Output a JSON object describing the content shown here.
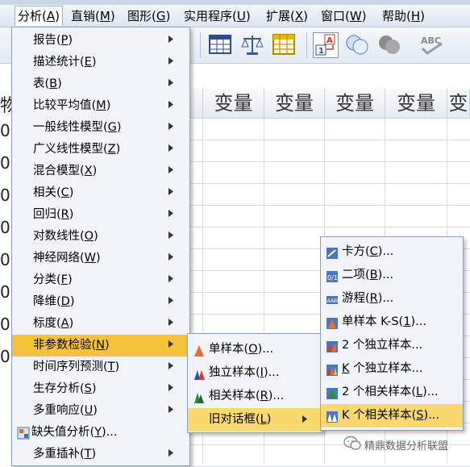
{
  "menubar": {
    "items": [
      {
        "label": "分析",
        "key": "A"
      },
      {
        "label": "直销",
        "key": "M"
      },
      {
        "label": "图形",
        "key": "G"
      },
      {
        "label": "实用程序",
        "key": "U"
      },
      {
        "label": "扩展",
        "key": "X"
      },
      {
        "label": "窗口",
        "key": "W"
      },
      {
        "label": "帮助",
        "key": "H"
      }
    ]
  },
  "toolbar": {
    "icons": [
      "table-icon",
      "scale-icon",
      "grid-icon",
      "value-labels-icon",
      "circles-icon",
      "sets-icon",
      "spell-check-icon"
    ],
    "abc_text": "ABC"
  },
  "grid": {
    "column_header": "变量",
    "left_partial_header": "物",
    "left_partial_cells": [
      "0",
      "0",
      "0",
      "0",
      "0",
      "0",
      "0",
      "0"
    ]
  },
  "analyze_menu": {
    "items": [
      {
        "label": "报告",
        "key": "P",
        "submenu": true
      },
      {
        "label": "描述统计",
        "key": "E",
        "submenu": true
      },
      {
        "label": "表",
        "key": "B",
        "submenu": true
      },
      {
        "label": "比较平均值",
        "key": "M",
        "submenu": true
      },
      {
        "label": "一般线性模型",
        "key": "G",
        "submenu": true
      },
      {
        "label": "广义线性模型",
        "key": "Z",
        "submenu": true
      },
      {
        "label": "混合模型",
        "key": "X",
        "submenu": true
      },
      {
        "label": "相关",
        "key": "C",
        "submenu": true
      },
      {
        "label": "回归",
        "key": "R",
        "submenu": true
      },
      {
        "label": "对数线性",
        "key": "O",
        "submenu": true
      },
      {
        "label": "神经网络",
        "key": "W",
        "submenu": true
      },
      {
        "label": "分类",
        "key": "F",
        "submenu": true
      },
      {
        "label": "降维",
        "key": "D",
        "submenu": true
      },
      {
        "label": "标度",
        "key": "A",
        "submenu": true
      },
      {
        "label": "非参数检验",
        "key": "N",
        "submenu": true,
        "highlighted": true
      },
      {
        "label": "时间序列预测",
        "key": "T",
        "submenu": true
      },
      {
        "label": "生存分析",
        "key": "S",
        "submenu": true
      },
      {
        "label": "多重响应",
        "key": "U",
        "submenu": true
      },
      {
        "label": "缺失值分析",
        "key": "Y",
        "suffix": "...",
        "icon": "missing-value-icon"
      },
      {
        "label": "多重插补",
        "key": "T",
        "submenu": true
      }
    ]
  },
  "nonparam_menu": {
    "items": [
      {
        "label": "单样本",
        "key": "O",
        "suffix": "...",
        "icon": "one-sample-icon"
      },
      {
        "label": "独立样本",
        "key": "I",
        "suffix": "...",
        "icon": "independent-samples-icon"
      },
      {
        "label": "相关样本",
        "key": "R",
        "suffix": "...",
        "icon": "related-samples-icon"
      },
      {
        "label": "旧对话框",
        "key": "L",
        "submenu": true,
        "highlighted": true
      }
    ]
  },
  "legacy_menu": {
    "items": [
      {
        "label": "卡方",
        "key": "C",
        "suffix": "...",
        "icon": "chi-square-icon"
      },
      {
        "label": "二项",
        "key": "B",
        "suffix": "...",
        "icon": "binomial-icon"
      },
      {
        "label": "游程",
        "key": "R",
        "suffix": "...",
        "icon": "runs-icon"
      },
      {
        "label": "单样本 K-S",
        "key": "1",
        "suffix": "...",
        "icon": "ks-icon"
      },
      {
        "label": "2 个独立样本",
        "key": "",
        "suffix": "...",
        "icon": "two-independent-icon"
      },
      {
        "label": "K 个独立样本",
        "key": "K",
        "suffix": "...",
        "icon": "k-independent-icon",
        "key_first": true
      },
      {
        "label": "2 个相关样本",
        "key": "L",
        "suffix": "...",
        "icon": "two-related-icon"
      },
      {
        "label": "K 个相关样本",
        "key": "S",
        "suffix": "...",
        "icon": "k-related-icon",
        "highlighted": true
      }
    ]
  },
  "watermark": {
    "text": "精鼎数据分析联盟"
  },
  "colors": {
    "highlight": "#f5c33b",
    "menu_bg": "#f0f4f9",
    "menu_border": "#8aa0bd"
  }
}
